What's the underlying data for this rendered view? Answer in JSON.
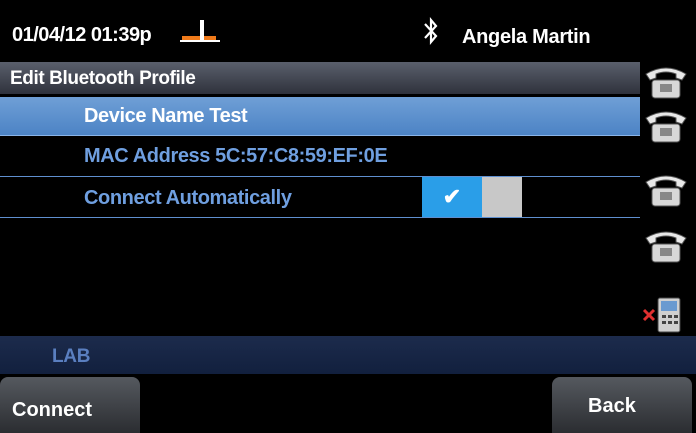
{
  "status_bar": {
    "datetime": "01/04/12 01:39p",
    "user_name": "Angela Martin",
    "icons": [
      "offhook-icon",
      "bluetooth-icon"
    ]
  },
  "header": {
    "title": "Edit Bluetooth Profile"
  },
  "profile": {
    "device_name_label": "Device Name Test",
    "mac_label": "MAC Address 5C:57:C8:59:EF:0E",
    "connect_auto_label": "Connect Automatically",
    "connect_auto_on": true,
    "toggle_mark": "✔"
  },
  "line_keys": [
    "phone-line-icon",
    "phone-line-icon",
    "phone-line-icon",
    "phone-line-icon",
    "mobile-phone-disconnected-icon"
  ],
  "lab_label": "LAB",
  "softkeys": {
    "connect": "Connect",
    "back": "Back"
  },
  "colors": {
    "highlight": "#4c83c5",
    "toggle_on": "#2a9ee8",
    "toggle_off": "#c8c8c8",
    "lab_bar": "#1c2b4c"
  }
}
